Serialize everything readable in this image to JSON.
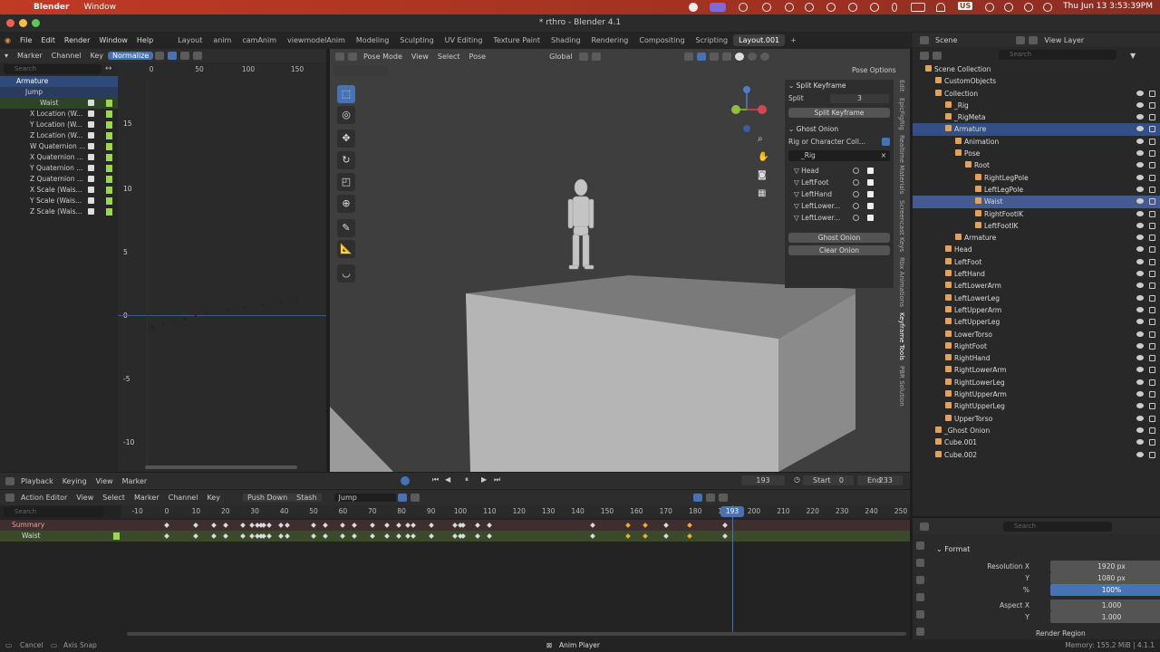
{
  "mac": {
    "app": "Blender",
    "menu": "Window",
    "clock": "Thu Jun 13  3:53:39PM",
    "us": "US"
  },
  "window": {
    "title": "* rthro - Blender 4.1"
  },
  "menu": {
    "items": [
      "File",
      "Edit",
      "Render",
      "Window",
      "Help"
    ],
    "tabs": [
      "Layout",
      "anim",
      "camAnim",
      "viewmodelAnim",
      "Modeling",
      "Sculpting",
      "UV Editing",
      "Texture Paint",
      "Shading",
      "Rendering",
      "Compositing",
      "Scripting",
      "Layout.001",
      "+"
    ]
  },
  "graph": {
    "header": [
      "Marker",
      "Channel",
      "Key",
      "Normalize"
    ],
    "search_placeholder": "Search",
    "ruler": [
      "0",
      "50",
      "100",
      "150"
    ],
    "yvals": [
      "15",
      "10",
      "5",
      "0",
      "-5",
      "-10"
    ],
    "channels": [
      "Armature",
      "Jump",
      "Waist",
      "X Location (W...",
      "Y Location (W...",
      "Z Location (W...",
      "W Quaternion ...",
      "X Quaternion ...",
      "Y Quaternion ...",
      "Z Quaternion ...",
      "X Scale (Wais...",
      "Y Scale (Wais...",
      "Z Scale (Wais..."
    ]
  },
  "viewport": {
    "header": [
      "Pose Mode",
      "View",
      "Select",
      "Pose",
      "Global"
    ],
    "pose_options": "Pose Options"
  },
  "npanel": {
    "split_title": "Split Keyframe",
    "split_label": "Split",
    "split_value": "3",
    "split_button": "Split Keyframe",
    "ghost_title": "Ghost Onion",
    "rig_label": "Rig or Character Coll...",
    "rig_value": "_Rig",
    "bones": [
      "Head",
      "LeftFoot",
      "LeftHand",
      "LeftLower...",
      "LeftLower..."
    ],
    "ghost_button": "Ghost Onion",
    "clear_button": "Clear Onion"
  },
  "vtabs": [
    "Edit",
    "EpicFigRig",
    "Realtime Materials",
    "Screencast Keys",
    "Rbx Animations",
    "Keyframe Tools",
    "PBR Solution"
  ],
  "outliner": {
    "scene": "Scene",
    "view_layer": "View Layer",
    "search_placeholder": "Search",
    "rows": [
      {
        "t": "Scene Collection",
        "d": 0
      },
      {
        "t": "CustomObjects",
        "d": 1
      },
      {
        "t": "Collection",
        "d": 1
      },
      {
        "t": "_Rig",
        "d": 2
      },
      {
        "t": "_RigMeta",
        "d": 2
      },
      {
        "t": "Armature",
        "d": 2,
        "sel": true
      },
      {
        "t": "Animation",
        "d": 3
      },
      {
        "t": "Pose",
        "d": 3
      },
      {
        "t": "Root",
        "d": 4
      },
      {
        "t": "RightLegPole",
        "d": 5
      },
      {
        "t": "LeftLegPole",
        "d": 5
      },
      {
        "t": "Waist",
        "d": 5,
        "sel": true
      },
      {
        "t": "RightFootIK",
        "d": 5
      },
      {
        "t": "LeftFootIK",
        "d": 5
      },
      {
        "t": "Armature",
        "d": 3
      },
      {
        "t": "Head",
        "d": 2
      },
      {
        "t": "LeftFoot",
        "d": 2
      },
      {
        "t": "LeftHand",
        "d": 2
      },
      {
        "t": "LeftLowerArm",
        "d": 2
      },
      {
        "t": "LeftLowerLeg",
        "d": 2
      },
      {
        "t": "LeftUpperArm",
        "d": 2
      },
      {
        "t": "LeftUpperLeg",
        "d": 2
      },
      {
        "t": "LowerTorso",
        "d": 2
      },
      {
        "t": "RightFoot",
        "d": 2
      },
      {
        "t": "RightHand",
        "d": 2
      },
      {
        "t": "RightLowerArm",
        "d": 2
      },
      {
        "t": "RightLowerLeg",
        "d": 2
      },
      {
        "t": "RightUpperArm",
        "d": 2
      },
      {
        "t": "RightUpperLeg",
        "d": 2
      },
      {
        "t": "UpperTorso",
        "d": 2
      },
      {
        "t": "_Ghost Onion",
        "d": 1
      },
      {
        "t": "Cube.001",
        "d": 1
      },
      {
        "t": "Cube.002",
        "d": 1
      }
    ]
  },
  "timeline": {
    "playback": "Playback",
    "keying": "Keying",
    "view": "View",
    "marker": "Marker",
    "current": "193",
    "start_label": "Start",
    "start": "0",
    "end_label": "End",
    "end": "233"
  },
  "dopesheet": {
    "mode": "Action Editor",
    "menu": [
      "View",
      "Select",
      "Marker",
      "Channel",
      "Key"
    ],
    "push_down": "Push Down",
    "stash": "Stash",
    "action": "Jump",
    "search_placeholder": "Search",
    "summary": "Summary",
    "waist": "Waist",
    "ruler": [
      "-10",
      "0",
      "10",
      "20",
      "30",
      "40",
      "50",
      "60",
      "70",
      "80",
      "90",
      "100",
      "110",
      "120",
      "130",
      "140",
      "150",
      "160",
      "170",
      "180",
      "190",
      "200",
      "210",
      "220",
      "230",
      "240",
      "250"
    ],
    "playhead": "193",
    "keys_white": [
      0,
      10,
      16,
      20,
      26,
      29,
      31,
      32,
      33,
      35,
      39,
      41,
      50,
      54,
      60,
      64,
      70,
      75,
      79,
      82,
      84,
      90,
      98,
      100,
      101,
      106,
      110,
      145,
      170,
      190
    ],
    "keys_orange": [
      157,
      163,
      178
    ]
  },
  "props": {
    "format": "Format",
    "search_placeholder": "Search",
    "rows": [
      {
        "label": "Resolution X",
        "value": "1920 px"
      },
      {
        "label": "Y",
        "value": "1080 px"
      },
      {
        "label": "%",
        "value": "100%"
      },
      {
        "label": "Aspect X",
        "value": "1.000"
      },
      {
        "label": "Y",
        "value": "1.000"
      }
    ],
    "render_region": "Render Region"
  },
  "status": {
    "cancel": "Cancel",
    "axis_snap": "Axis Snap",
    "center": "Anim Player",
    "memory": "Memory: 155.2 MiB | 4.1.1"
  }
}
